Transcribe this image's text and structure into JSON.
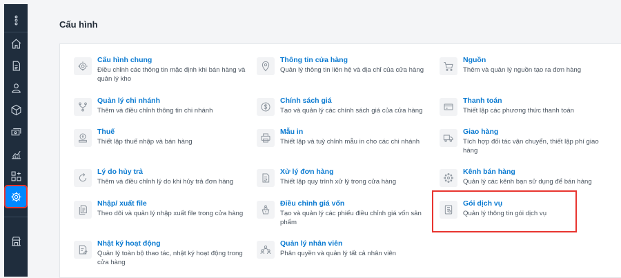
{
  "page": {
    "title": "Cấu hình"
  },
  "sidebar": {
    "active": "settings",
    "icons": [
      "more-vertical-icon",
      "home-icon",
      "order-document-icon",
      "customer-icon",
      "product-box-icon",
      "cash-icon",
      "report-chart-icon",
      "apps-icon",
      "settings-gear-icon",
      "store-icon"
    ]
  },
  "settings": {
    "items": [
      {
        "name": "Cấu hình chung",
        "desc": "Điều chỉnh các thông tin mặc định khi bán hàng và quản lý kho",
        "icon": "gear-icon"
      },
      {
        "name": "Thông tin cửa hàng",
        "desc": "Quản lý thông tin liên hệ và địa chỉ của cửa hàng",
        "icon": "location-pin-icon"
      },
      {
        "name": "Nguồn",
        "desc": "Thêm và quản lý nguồn tạo ra đơn hàng",
        "icon": "cart-icon"
      },
      {
        "name": "Quản lý chi nhánh",
        "desc": "Thêm và điều chỉnh thông tin chi nhánh",
        "icon": "branch-icon"
      },
      {
        "name": "Chính sách giá",
        "desc": "Tạo và quản lý các chính sách giá của cửa hàng",
        "icon": "dollar-icon"
      },
      {
        "name": "Thanh toán",
        "desc": "Thiết lập các phương thức thanh toán",
        "icon": "credit-card-icon"
      },
      {
        "name": "Thuế",
        "desc": "Thiết lập thuế nhập và bán hàng",
        "icon": "tax-icon"
      },
      {
        "name": "Mẫu in",
        "desc": "Thiết lập và tuỳ chỉnh mẫu in cho các chi nhánh",
        "icon": "printer-icon"
      },
      {
        "name": "Giao hàng",
        "desc": "Tích hợp đối tác vận chuyển, thiết lập phí giao hàng",
        "icon": "truck-icon"
      },
      {
        "name": "Lý do hủy trả",
        "desc": "Thêm và điều chỉnh lý do khi hủy trả đơn hàng",
        "icon": "refresh-icon"
      },
      {
        "name": "Xử lý đơn hàng",
        "desc": "Thiết lập quy trình xử lý trong cửa hàng",
        "icon": "order-process-icon"
      },
      {
        "name": "Kênh bán hàng",
        "desc": "Quản lý các kênh bạn sử dụng để bán hàng",
        "icon": "channels-icon"
      },
      {
        "name": "Nhập/ xuất file",
        "desc": "Theo dõi và quản lý nhập xuất file trong cửa hàng",
        "icon": "file-icon"
      },
      {
        "name": "Điều chỉnh giá vốn",
        "desc": "Tạo và quản lý các phiếu điều chỉnh giá vốn sản phẩm",
        "icon": "cost-adjust-icon"
      },
      {
        "name": "Gói dịch vụ",
        "desc": "Quản lý thông tin gói dịch vụ",
        "icon": "service-package-icon"
      },
      {
        "name": "Nhật ký hoạt động",
        "desc": "Quản lý toàn bộ thao tác, nhật ký hoạt động trong cửa hàng",
        "icon": "activity-log-icon"
      },
      {
        "name": "Quản lý nhân viên",
        "desc": "Phân quyền và quản lý tất cả nhân viên",
        "icon": "staff-icon"
      }
    ]
  }
}
